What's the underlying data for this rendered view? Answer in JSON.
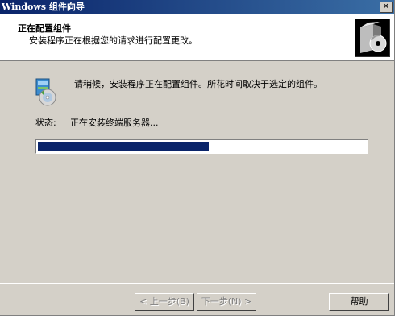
{
  "window": {
    "title": "Windows 组件向导",
    "close_glyph": "✕"
  },
  "header": {
    "title": "正在配置组件",
    "subtitle": "安装程序正在根据您的请求进行配置更改。",
    "icon": "cd-box-icon"
  },
  "main": {
    "message": "请稍候，安装程序正在配置组件。所花时间取决于选定的组件。",
    "status_label": "状态:",
    "status_value": "正在安装终端服务器...",
    "progress": 0.52
  },
  "buttons": {
    "back_label": "< 上一步(B)",
    "next_label": "下一步(N) >",
    "help_label": "帮助"
  },
  "colors": {
    "progress_fill": "#0a246a",
    "titlebar": "#0a246a",
    "dialog_bg": "#d4d0c8"
  }
}
